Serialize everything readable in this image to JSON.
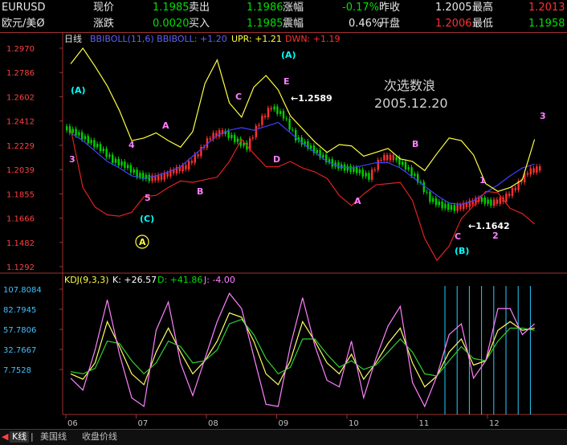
{
  "header": {
    "symbol": "EURUSD",
    "pair_cn": "欧元/美Ø",
    "row1": [
      {
        "label": "现价",
        "value": "1.1985"
      },
      {
        "label": "卖出",
        "value": "1.1986"
      },
      {
        "label": "涨幅",
        "value": "-0.17%"
      },
      {
        "label": "昨收",
        "value": "1.2005"
      },
      {
        "label": "最高",
        "value": "1.2013"
      }
    ],
    "row2": [
      {
        "label": "涨跌",
        "value": "0.0020"
      },
      {
        "label": "买入",
        "value": "1.1985"
      },
      {
        "label": "震幅",
        "value": "0.46%"
      },
      {
        "label": "开盘",
        "value": "1.2006"
      },
      {
        "label": "最低",
        "value": "1.1958"
      }
    ]
  },
  "main_legend": {
    "period": "日线",
    "boll": "BBIBOLL(11,6) BBIBOLL: +1.20",
    "upr": "UPR: +1.21",
    "dwn": "DWN: +1.19"
  },
  "kdj_legend": {
    "name": "KDJ(9,3,3)",
    "k": "K: +26.57",
    "d": "D: +41.86",
    "j": "J: -4.00"
  },
  "chart_data": [
    {
      "type": "line",
      "title": "日线",
      "yticks": [
        "1.2970",
        "1.2786",
        "1.2602",
        "1.2412",
        "1.2229",
        "1.2039",
        "1.1855",
        "1.1666",
        "1.1482",
        "1.1292"
      ],
      "ylim": [
        1.1292,
        1.297
      ],
      "x_categories": [
        "06",
        "07",
        "08",
        "09",
        "10",
        "11",
        "12"
      ],
      "series": [
        {
          "name": "BBIBOLL",
          "color": "#4040ff",
          "values": [
            1.232,
            1.226,
            1.218,
            1.21,
            1.205,
            1.199,
            1.197,
            1.199,
            1.202,
            1.206,
            1.214,
            1.222,
            1.23,
            1.234,
            1.236,
            1.234,
            1.237,
            1.24,
            1.232,
            1.224,
            1.217,
            1.21,
            1.206,
            1.205,
            1.207,
            1.209,
            1.209,
            1.205,
            1.198,
            1.191,
            1.184,
            1.178,
            1.177,
            1.18,
            1.186,
            1.192,
            1.199,
            1.205,
            1.208
          ]
        },
        {
          "name": "UPR",
          "color": "#ffff40",
          "values": [
            1.285,
            1.297,
            1.283,
            1.268,
            1.249,
            1.226,
            1.228,
            1.232,
            1.226,
            1.221,
            1.233,
            1.27,
            1.288,
            1.255,
            1.244,
            1.267,
            1.276,
            1.265,
            1.245,
            1.235,
            1.225,
            1.217,
            1.223,
            1.222,
            1.214,
            1.217,
            1.22,
            1.212,
            1.21,
            1.203,
            1.216,
            1.228,
            1.226,
            1.215,
            1.193,
            1.187,
            1.19,
            1.196,
            1.227
          ]
        },
        {
          "name": "DWN",
          "color": "#e02020",
          "values": [
            1.235,
            1.19,
            1.175,
            1.169,
            1.168,
            1.171,
            1.183,
            1.184,
            1.19,
            1.195,
            1.194,
            1.196,
            1.198,
            1.21,
            1.227,
            1.216,
            1.206,
            1.206,
            1.21,
            1.205,
            1.202,
            1.197,
            1.184,
            1.176,
            1.185,
            1.192,
            1.193,
            1.194,
            1.18,
            1.151,
            1.134,
            1.145,
            1.166,
            1.176,
            1.187,
            1.186,
            1.174,
            1.17,
            1.162
          ]
        }
      ],
      "candles": {
        "close": [
          1.232,
          1.226,
          1.22,
          1.211,
          1.207,
          1.2,
          1.197,
          1.198,
          1.203,
          1.206,
          1.216,
          1.229,
          1.233,
          1.227,
          1.221,
          1.24,
          1.252,
          1.245,
          1.228,
          1.222,
          1.215,
          1.208,
          1.205,
          1.203,
          1.198,
          1.213,
          1.213,
          1.206,
          1.196,
          1.181,
          1.176,
          1.174,
          1.177,
          1.181,
          1.178,
          1.181,
          1.19,
          1.202,
          1.205
        ],
        "open": [
          1.236,
          1.232,
          1.226,
          1.22,
          1.211,
          1.207,
          1.2,
          1.197,
          1.198,
          1.203,
          1.206,
          1.216,
          1.229,
          1.233,
          1.227,
          1.221,
          1.24,
          1.252,
          1.245,
          1.228,
          1.222,
          1.215,
          1.208,
          1.205,
          1.203,
          1.198,
          1.213,
          1.213,
          1.206,
          1.196,
          1.181,
          1.176,
          1.174,
          1.177,
          1.181,
          1.178,
          1.181,
          1.19,
          1.202
        ]
      },
      "annotations": [
        {
          "text": "(A)",
          "color": "#00ffff"
        },
        {
          "text": "3",
          "color": "#ff80ff"
        },
        {
          "text": "4",
          "color": "#ff80ff"
        },
        {
          "text": "5",
          "color": "#ff80ff"
        },
        {
          "text": "(C)",
          "color": "#00ffff"
        },
        {
          "text": "A",
          "color": "#ff80ff"
        },
        {
          "text": "B",
          "color": "#ff80ff"
        },
        {
          "text": "C",
          "color": "#ff80ff"
        },
        {
          "text": "D",
          "color": "#ff80ff"
        },
        {
          "text": "E",
          "color": "#ff80ff"
        },
        {
          "text": "(A)",
          "color": "#00ffff"
        },
        {
          "text": "←1.2589",
          "color": "#ffffff"
        },
        {
          "text": "A",
          "color": "#ff80ff"
        },
        {
          "text": "B",
          "color": "#ff80ff"
        },
        {
          "text": "C",
          "color": "#ff80ff"
        },
        {
          "text": "←1.1642",
          "color": "#ffffff"
        },
        {
          "text": "(B)",
          "color": "#00ffff"
        },
        {
          "text": "1",
          "color": "#ff80ff"
        },
        {
          "text": "2",
          "color": "#ff80ff"
        },
        {
          "text": "3",
          "color": "#ff80ff"
        }
      ],
      "circled_label": "A",
      "watermark_line1": "次选数浪",
      "watermark_line2": "2005.12.20"
    },
    {
      "type": "line",
      "title": "KDJ(9,3,3)",
      "yticks": [
        "107.8084",
        "82.7945",
        "57.7806",
        "32.7667",
        "7.7528"
      ],
      "ylim": [
        0,
        107.8084
      ],
      "series": [
        {
          "name": "K",
          "color": "#ffffff",
          "values": [
            30,
            25,
            40,
            78,
            55,
            30,
            20,
            50,
            72,
            50,
            30,
            42,
            60,
            86,
            82,
            60,
            30,
            20,
            42,
            78,
            60,
            40,
            30,
            48,
            25,
            40,
            58,
            72,
            40,
            18,
            28,
            50,
            62,
            38,
            42,
            70,
            78,
            70,
            72
          ]
        },
        {
          "name": "D",
          "color": "#ffff40",
          "values": [
            32,
            30,
            35,
            60,
            58,
            42,
            30,
            40,
            60,
            55,
            40,
            42,
            52,
            76,
            80,
            66,
            44,
            30,
            36,
            62,
            62,
            48,
            36,
            42,
            34,
            38,
            50,
            62,
            50,
            30,
            28,
            42,
            55,
            44,
            42,
            60,
            72,
            72,
            70
          ]
        },
        {
          "name": "J",
          "color": "#ff80ff",
          "values": [
            26,
            15,
            52,
            98,
            48,
            8,
            0,
            70,
            96,
            40,
            10,
            44,
            78,
            104,
            90,
            46,
            2,
            0,
            56,
            100,
            56,
            24,
            18,
            60,
            8,
            44,
            74,
            92,
            22,
            0,
            28,
            66,
            76,
            26,
            42,
            90,
            90,
            66,
            76
          ]
        }
      ]
    }
  ],
  "xaxis_labels": [
    "06",
    "07",
    "08",
    "09",
    "10",
    "11",
    "12"
  ],
  "bottom_tabs": [
    "K线",
    "美国线",
    "收盘价线"
  ]
}
